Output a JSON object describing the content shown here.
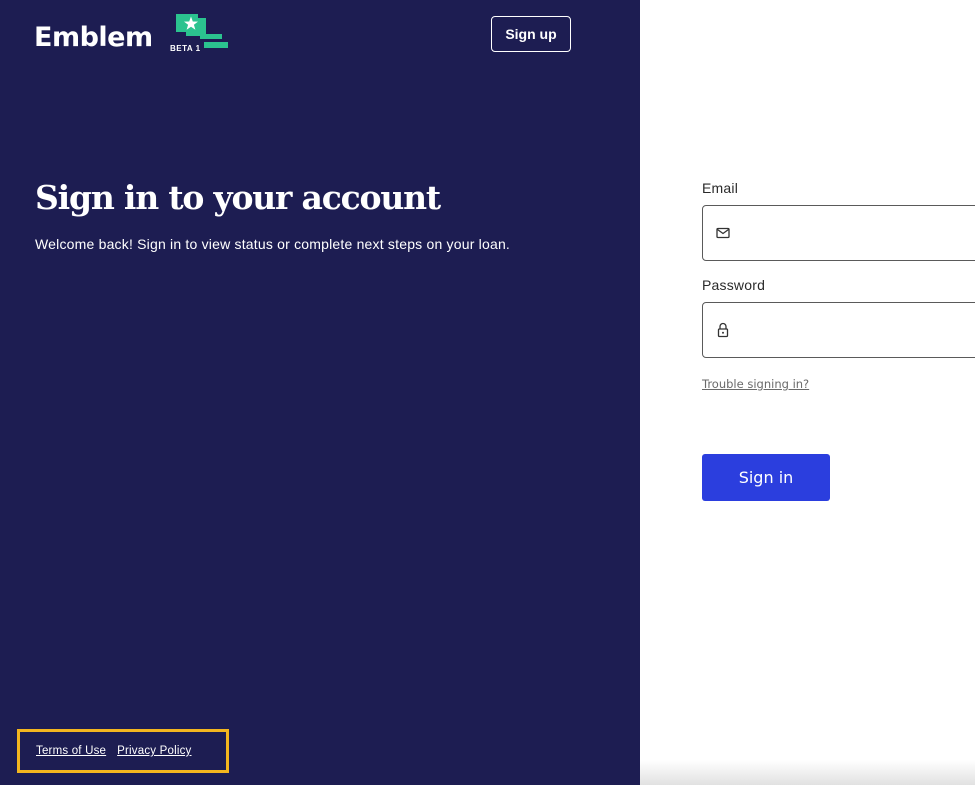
{
  "brand": {
    "name": "Emblem",
    "badge": "BETA 1",
    "colors": {
      "panel": "#1d1d52",
      "accent_green": "#2bc38f",
      "primary_button": "#2b3ede",
      "highlight": "#f3b61f"
    }
  },
  "header": {
    "signup_label": "Sign up"
  },
  "hero": {
    "title": "Sign in to your account",
    "subtitle": "Welcome back! Sign in to view status or complete next steps on your loan."
  },
  "form": {
    "email": {
      "label": "Email",
      "value": "",
      "icon": "mail-icon"
    },
    "password": {
      "label": "Password",
      "value": "",
      "icon": "lock-icon"
    },
    "trouble_link": "Trouble signing in?",
    "submit_label": "Sign in"
  },
  "footer": {
    "links": [
      "Terms of Use",
      "Privacy Policy"
    ]
  }
}
